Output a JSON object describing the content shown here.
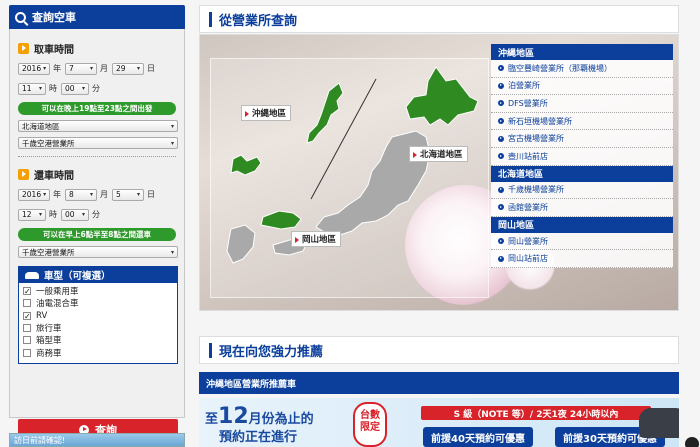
{
  "sidebar": {
    "title": "查詢空車",
    "pickup": {
      "title": "取車時間",
      "year": "2016",
      "year_unit": "年",
      "month": "7",
      "month_unit": "月",
      "day": "29",
      "day_unit": "日",
      "hour": "11",
      "hour_unit": "時",
      "minute": "00",
      "minute_unit": "分",
      "notice": "可以在晚上19點至23點之間出發",
      "region": "北海道地區",
      "office": "千歲空港營業所"
    },
    "dropoff": {
      "title": "還車時間",
      "year": "2016",
      "year_unit": "年",
      "month": "8",
      "month_unit": "月",
      "day": "5",
      "day_unit": "日",
      "hour": "12",
      "hour_unit": "時",
      "minute": "00",
      "minute_unit": "分",
      "notice": "可以在早上6點半至8點之間還車",
      "office": "千歲空港營業所"
    },
    "car_type": {
      "title": "車型（可複選）",
      "items": [
        {
          "label": "一般乘用車",
          "checked": true
        },
        {
          "label": "油電混合車",
          "checked": false
        },
        {
          "label": "RV",
          "checked": true
        },
        {
          "label": "旅行車",
          "checked": false
        },
        {
          "label": "箱型車",
          "checked": false
        },
        {
          "label": "商務車",
          "checked": false
        }
      ]
    },
    "search_label": "查詢",
    "bottom_notice": "訪日前請確認!"
  },
  "offices_section": {
    "title": "從營業所查詢",
    "map_labels": {
      "okinawa": "沖縄地區",
      "hokkaido": "北海道地區",
      "okayama": "岡山地區"
    },
    "regions": [
      {
        "name": "沖縄地區",
        "offices": [
          "臨空豐崎營業所（那覇機場）",
          "泊營業所",
          "DFS營業所",
          "新石垣機場營業所",
          "宮古機場營業所",
          "壺川站前店"
        ]
      },
      {
        "name": "北海道地區",
        "offices": [
          "千歲機場營業所",
          "函館營業所"
        ]
      },
      {
        "name": "岡山地區",
        "offices": [
          "岡山營業所",
          "岡山站前店"
        ]
      }
    ]
  },
  "recommend": {
    "title": "現在向您強力推薦",
    "strip": "沖縄地區營業所推薦車"
  },
  "banner": {
    "left_line1_a": "至",
    "left_line1_b": "12",
    "left_line1_c": "月份為止的",
    "left_line2": "預約正在進行",
    "badge_line1": "台數",
    "badge_line2": "限定",
    "top_text": "S 級（NOTE 等）/ 2天1夜 24小時以內",
    "btn1": "前援40天預約可優惠",
    "btn2": "前援30天預約可優惠"
  },
  "colors": {
    "primary": "#0b3f9b",
    "green": "#2e9a2b",
    "red": "#d8232a",
    "orange": "#f5a000"
  }
}
